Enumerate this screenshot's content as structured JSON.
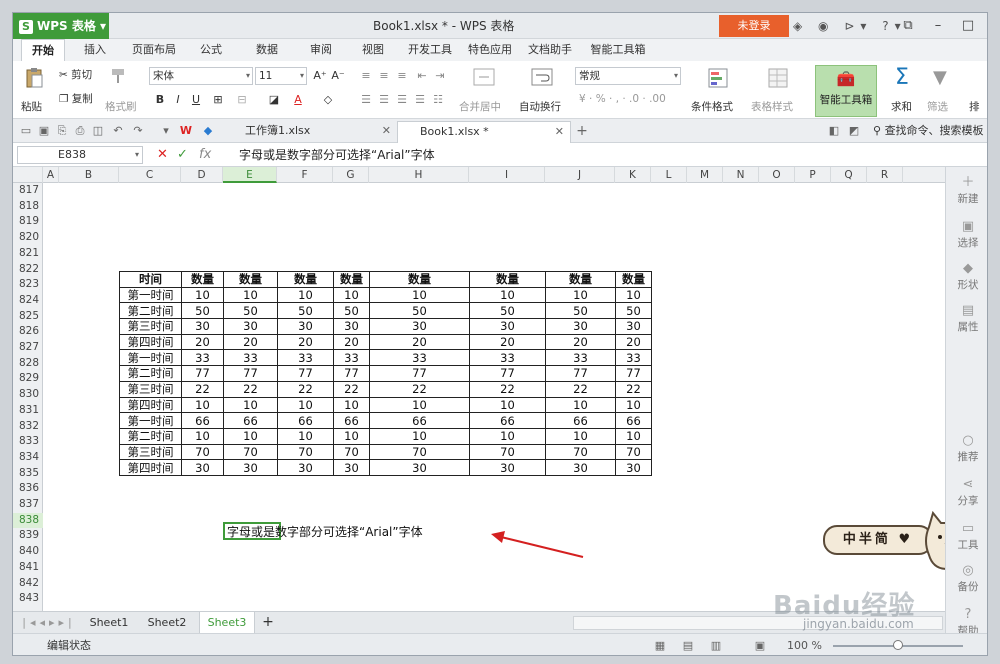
{
  "app": {
    "menu_button": "WPS 表格",
    "title": "Book1.xlsx * - WPS 表格",
    "login": "未登录"
  },
  "tabs": [
    "开始",
    "插入",
    "页面布局",
    "公式",
    "数据",
    "审阅",
    "视图",
    "开发工具",
    "特色应用",
    "文档助手",
    "智能工具箱"
  ],
  "ribbon": {
    "paste": "粘贴",
    "cut": "剪切",
    "copy": "复制",
    "format_painter": "格式刷",
    "font_name": "宋体",
    "font_size": "11",
    "merge_center": "合并居中",
    "wrap_text": "自动换行",
    "number_format": "常规",
    "conditional_format": "条件格式",
    "table_style": "表格样式",
    "smart_toolbox": "智能工具箱",
    "sum": "求和",
    "filter": "筛选",
    "sort": "排"
  },
  "doc_tabs": [
    {
      "label": "工作簿1.xlsx"
    },
    {
      "label": "Book1.xlsx *"
    }
  ],
  "search_command": "查找命令、搜索模板",
  "formula_bar": {
    "cell_ref": "E838",
    "content": "字母或是数字部分可选择“Arial”字体"
  },
  "columns": [
    "A",
    "B",
    "C",
    "D",
    "E",
    "F",
    "G",
    "H",
    "I",
    "J",
    "K",
    "L",
    "M",
    "N",
    "O",
    "P",
    "Q",
    "R"
  ],
  "selected_column": "E",
  "rows": [
    "817",
    "818",
    "819",
    "820",
    "821",
    "822",
    "823",
    "824",
    "825",
    "826",
    "827",
    "828",
    "829",
    "830",
    "831",
    "832",
    "833",
    "834",
    "835",
    "836",
    "837",
    "838",
    "839",
    "840",
    "841",
    "842",
    "843"
  ],
  "selected_row": "838",
  "table": {
    "headers": [
      "时间",
      "数量",
      "数量",
      "数量",
      "数量",
      "数量",
      "数量",
      "数量",
      "数量"
    ],
    "rows": [
      [
        "第一时间",
        "10",
        "10",
        "10",
        "10",
        "10",
        "10",
        "10",
        "10"
      ],
      [
        "第二时间",
        "50",
        "50",
        "50",
        "50",
        "50",
        "50",
        "50",
        "50"
      ],
      [
        "第三时间",
        "30",
        "30",
        "30",
        "30",
        "30",
        "30",
        "30",
        "30"
      ],
      [
        "第四时间",
        "20",
        "20",
        "20",
        "20",
        "20",
        "20",
        "20",
        "20"
      ],
      [
        "第一时间",
        "33",
        "33",
        "33",
        "33",
        "33",
        "33",
        "33",
        "33"
      ],
      [
        "第二时间",
        "77",
        "77",
        "77",
        "77",
        "77",
        "77",
        "77",
        "77"
      ],
      [
        "第三时间",
        "22",
        "22",
        "22",
        "22",
        "22",
        "22",
        "22",
        "22"
      ],
      [
        "第四时间",
        "10",
        "10",
        "10",
        "10",
        "10",
        "10",
        "10",
        "10"
      ],
      [
        "第一时间",
        "66",
        "66",
        "66",
        "66",
        "66",
        "66",
        "66",
        "66"
      ],
      [
        "第二时间",
        "10",
        "10",
        "10",
        "10",
        "10",
        "10",
        "10",
        "10"
      ],
      [
        "第三时间",
        "70",
        "70",
        "70",
        "70",
        "70",
        "70",
        "70",
        "70"
      ],
      [
        "第四时间",
        "30",
        "30",
        "30",
        "30",
        "30",
        "30",
        "30",
        "30"
      ]
    ]
  },
  "note_text": "字母或是数字部分可选择“Arial”字体",
  "sticker_text": "中半简",
  "sidebar": [
    "新建",
    "选择",
    "形状",
    "属性",
    "推荐",
    "分享",
    "工具",
    "备份",
    "帮助"
  ],
  "sheets": [
    "Sheet1",
    "Sheet2",
    "Sheet3"
  ],
  "active_sheet": "Sheet3",
  "status": {
    "mode": "编辑状态",
    "zoom": "100 %"
  },
  "watermark": {
    "brand": "Baidu经验",
    "url": "jingyan.baidu.com"
  },
  "colors": {
    "accent": "#3f9b3a",
    "login": "#e8602c",
    "arrow": "#d42020"
  }
}
